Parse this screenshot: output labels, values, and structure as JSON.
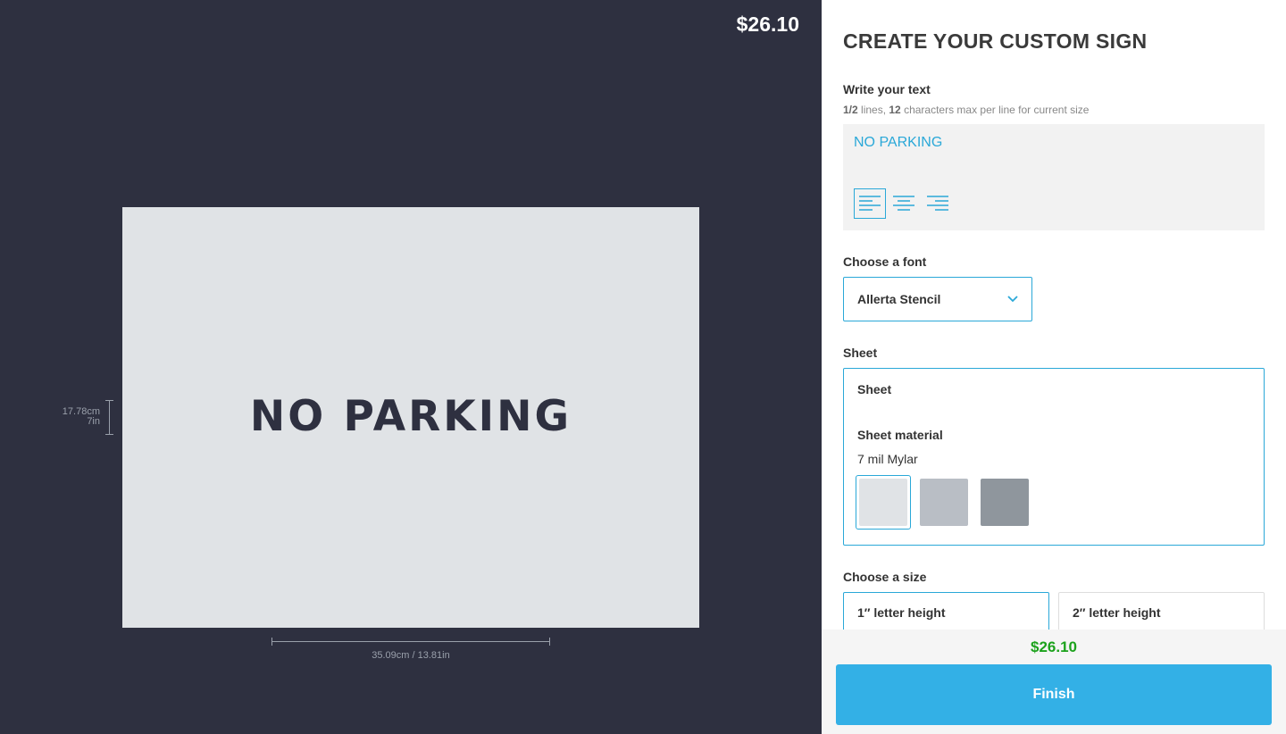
{
  "preview": {
    "price": "$26.10",
    "sign_text": "NO PARKING",
    "sign_color": "#e0e3e6",
    "height_cm": "17.78cm",
    "height_in": "7in",
    "width_label": "35.09cm / 13.81in"
  },
  "config": {
    "title": "CREATE YOUR CUSTOM SIGN",
    "text_section": {
      "label": "Write your text",
      "hint_lines": "1/2",
      "hint_lines_suffix": " lines, ",
      "hint_chars": "12",
      "hint_chars_suffix": " characters max per line for current size",
      "value": "NO PARKING",
      "alignment_options": [
        {
          "icon": "align-left-icon",
          "active": true
        },
        {
          "icon": "align-center-icon",
          "active": false
        },
        {
          "icon": "align-right-icon",
          "active": false
        }
      ]
    },
    "font_section": {
      "label": "Choose a font",
      "selected": "Allerta Stencil"
    },
    "sheet_section": {
      "label": "Sheet",
      "inner_title": "Sheet",
      "material_label": "Sheet material",
      "material_value": "7 mil Mylar",
      "swatches": [
        {
          "color": "#e0e3e6",
          "selected": true
        },
        {
          "color": "#b9bec5",
          "selected": false
        },
        {
          "color": "#8f969d",
          "selected": false
        }
      ]
    },
    "size_section": {
      "label": "Choose a size",
      "options": [
        {
          "label": "1″ letter height",
          "selected": true
        },
        {
          "label": "2″ letter height",
          "selected": false
        }
      ]
    },
    "footer": {
      "price": "$26.10",
      "finish_label": "Finish"
    }
  },
  "colors": {
    "accent": "#2aa8d8",
    "button": "#33b0e6",
    "price_green": "#1ca21c",
    "preview_bg": "#2e3040"
  }
}
